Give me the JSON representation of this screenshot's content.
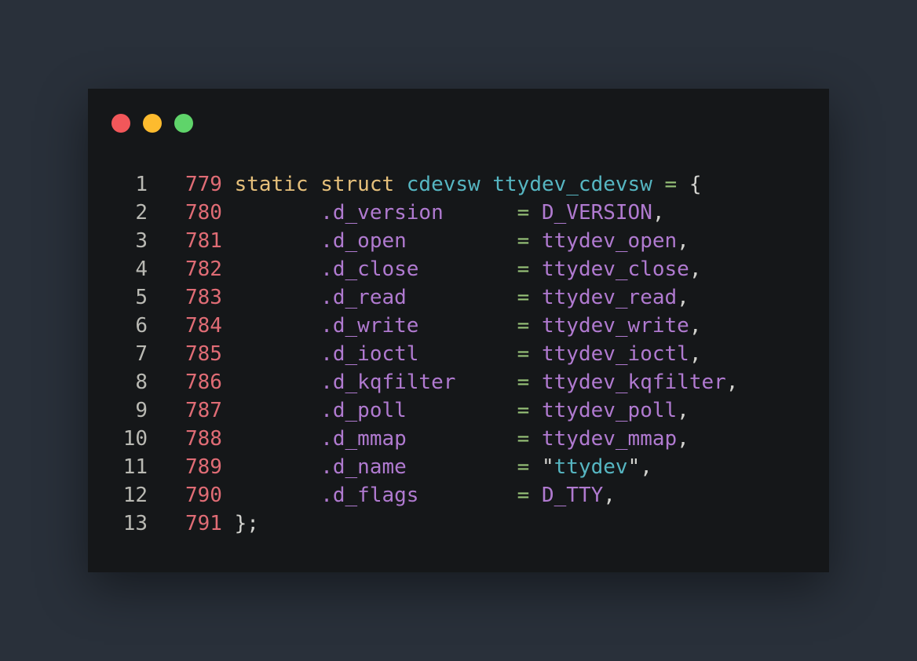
{
  "colors": {
    "background": "#29303a",
    "window": "#151719",
    "dot_red": "#f2575a",
    "dot_yellow": "#fdbb2e",
    "dot_green": "#5fd46a",
    "gutter": "#b9b9b3",
    "source_line": "#e06c75",
    "keyword": "#e6c07b",
    "type": "#56b6c2",
    "field": "#b07ad0",
    "operator": "#98c379",
    "punct": "#d3d3cf",
    "string_quote": "#d3d3cf",
    "string": "#56b6c2"
  },
  "window_controls": [
    "close",
    "minimize",
    "maximize"
  ],
  "code_lines": [
    {
      "n": "1",
      "tokens": [
        {
          "t": "779",
          "c": "source_line"
        },
        {
          "t": " ",
          "c": "punct"
        },
        {
          "t": "static",
          "c": "keyword"
        },
        {
          "t": " ",
          "c": "punct"
        },
        {
          "t": "struct",
          "c": "keyword"
        },
        {
          "t": " ",
          "c": "punct"
        },
        {
          "t": "cdevsw",
          "c": "type"
        },
        {
          "t": " ",
          "c": "punct"
        },
        {
          "t": "ttydev_cdevsw",
          "c": "type"
        },
        {
          "t": " ",
          "c": "punct"
        },
        {
          "t": "=",
          "c": "operator"
        },
        {
          "t": " {",
          "c": "punct"
        }
      ]
    },
    {
      "n": "2",
      "tokens": [
        {
          "t": "780",
          "c": "source_line"
        },
        {
          "t": "        ",
          "c": "punct"
        },
        {
          "t": ".d_version",
          "c": "field"
        },
        {
          "t": "      ",
          "c": "punct"
        },
        {
          "t": "=",
          "c": "operator"
        },
        {
          "t": " ",
          "c": "punct"
        },
        {
          "t": "D_VERSION",
          "c": "field"
        },
        {
          "t": ",",
          "c": "punct"
        }
      ]
    },
    {
      "n": "3",
      "tokens": [
        {
          "t": "781",
          "c": "source_line"
        },
        {
          "t": "        ",
          "c": "punct"
        },
        {
          "t": ".d_open",
          "c": "field"
        },
        {
          "t": "         ",
          "c": "punct"
        },
        {
          "t": "=",
          "c": "operator"
        },
        {
          "t": " ",
          "c": "punct"
        },
        {
          "t": "ttydev_open",
          "c": "field"
        },
        {
          "t": ",",
          "c": "punct"
        }
      ]
    },
    {
      "n": "4",
      "tokens": [
        {
          "t": "782",
          "c": "source_line"
        },
        {
          "t": "        ",
          "c": "punct"
        },
        {
          "t": ".d_close",
          "c": "field"
        },
        {
          "t": "        ",
          "c": "punct"
        },
        {
          "t": "=",
          "c": "operator"
        },
        {
          "t": " ",
          "c": "punct"
        },
        {
          "t": "ttydev_close",
          "c": "field"
        },
        {
          "t": ",",
          "c": "punct"
        }
      ]
    },
    {
      "n": "5",
      "tokens": [
        {
          "t": "783",
          "c": "source_line"
        },
        {
          "t": "        ",
          "c": "punct"
        },
        {
          "t": ".d_read",
          "c": "field"
        },
        {
          "t": "         ",
          "c": "punct"
        },
        {
          "t": "=",
          "c": "operator"
        },
        {
          "t": " ",
          "c": "punct"
        },
        {
          "t": "ttydev_read",
          "c": "field"
        },
        {
          "t": ",",
          "c": "punct"
        }
      ]
    },
    {
      "n": "6",
      "tokens": [
        {
          "t": "784",
          "c": "source_line"
        },
        {
          "t": "        ",
          "c": "punct"
        },
        {
          "t": ".d_write",
          "c": "field"
        },
        {
          "t": "        ",
          "c": "punct"
        },
        {
          "t": "=",
          "c": "operator"
        },
        {
          "t": " ",
          "c": "punct"
        },
        {
          "t": "ttydev_write",
          "c": "field"
        },
        {
          "t": ",",
          "c": "punct"
        }
      ]
    },
    {
      "n": "7",
      "tokens": [
        {
          "t": "785",
          "c": "source_line"
        },
        {
          "t": "        ",
          "c": "punct"
        },
        {
          "t": ".d_ioctl",
          "c": "field"
        },
        {
          "t": "        ",
          "c": "punct"
        },
        {
          "t": "=",
          "c": "operator"
        },
        {
          "t": " ",
          "c": "punct"
        },
        {
          "t": "ttydev_ioctl",
          "c": "field"
        },
        {
          "t": ",",
          "c": "punct"
        }
      ]
    },
    {
      "n": "8",
      "tokens": [
        {
          "t": "786",
          "c": "source_line"
        },
        {
          "t": "        ",
          "c": "punct"
        },
        {
          "t": ".d_kqfilter",
          "c": "field"
        },
        {
          "t": "     ",
          "c": "punct"
        },
        {
          "t": "=",
          "c": "operator"
        },
        {
          "t": " ",
          "c": "punct"
        },
        {
          "t": "ttydev_kqfilter",
          "c": "field"
        },
        {
          "t": ",",
          "c": "punct"
        }
      ]
    },
    {
      "n": "9",
      "tokens": [
        {
          "t": "787",
          "c": "source_line"
        },
        {
          "t": "        ",
          "c": "punct"
        },
        {
          "t": ".d_poll",
          "c": "field"
        },
        {
          "t": "         ",
          "c": "punct"
        },
        {
          "t": "=",
          "c": "operator"
        },
        {
          "t": " ",
          "c": "punct"
        },
        {
          "t": "ttydev_poll",
          "c": "field"
        },
        {
          "t": ",",
          "c": "punct"
        }
      ]
    },
    {
      "n": "10",
      "tokens": [
        {
          "t": "788",
          "c": "source_line"
        },
        {
          "t": "        ",
          "c": "punct"
        },
        {
          "t": ".d_mmap",
          "c": "field"
        },
        {
          "t": "         ",
          "c": "punct"
        },
        {
          "t": "=",
          "c": "operator"
        },
        {
          "t": " ",
          "c": "punct"
        },
        {
          "t": "ttydev_mmap",
          "c": "field"
        },
        {
          "t": ",",
          "c": "punct"
        }
      ]
    },
    {
      "n": "11",
      "tokens": [
        {
          "t": "789",
          "c": "source_line"
        },
        {
          "t": "        ",
          "c": "punct"
        },
        {
          "t": ".d_name",
          "c": "field"
        },
        {
          "t": "         ",
          "c": "punct"
        },
        {
          "t": "=",
          "c": "operator"
        },
        {
          "t": " ",
          "c": "punct"
        },
        {
          "t": "\"",
          "c": "string_quote"
        },
        {
          "t": "ttydev",
          "c": "string"
        },
        {
          "t": "\"",
          "c": "string_quote"
        },
        {
          "t": ",",
          "c": "punct"
        }
      ]
    },
    {
      "n": "12",
      "tokens": [
        {
          "t": "790",
          "c": "source_line"
        },
        {
          "t": "        ",
          "c": "punct"
        },
        {
          "t": ".d_flags",
          "c": "field"
        },
        {
          "t": "        ",
          "c": "punct"
        },
        {
          "t": "=",
          "c": "operator"
        },
        {
          "t": " ",
          "c": "punct"
        },
        {
          "t": "D_TTY",
          "c": "field"
        },
        {
          "t": ",",
          "c": "punct"
        }
      ]
    },
    {
      "n": "13",
      "tokens": [
        {
          "t": "791",
          "c": "source_line"
        },
        {
          "t": " ",
          "c": "punct"
        },
        {
          "t": "};",
          "c": "punct"
        }
      ]
    }
  ]
}
